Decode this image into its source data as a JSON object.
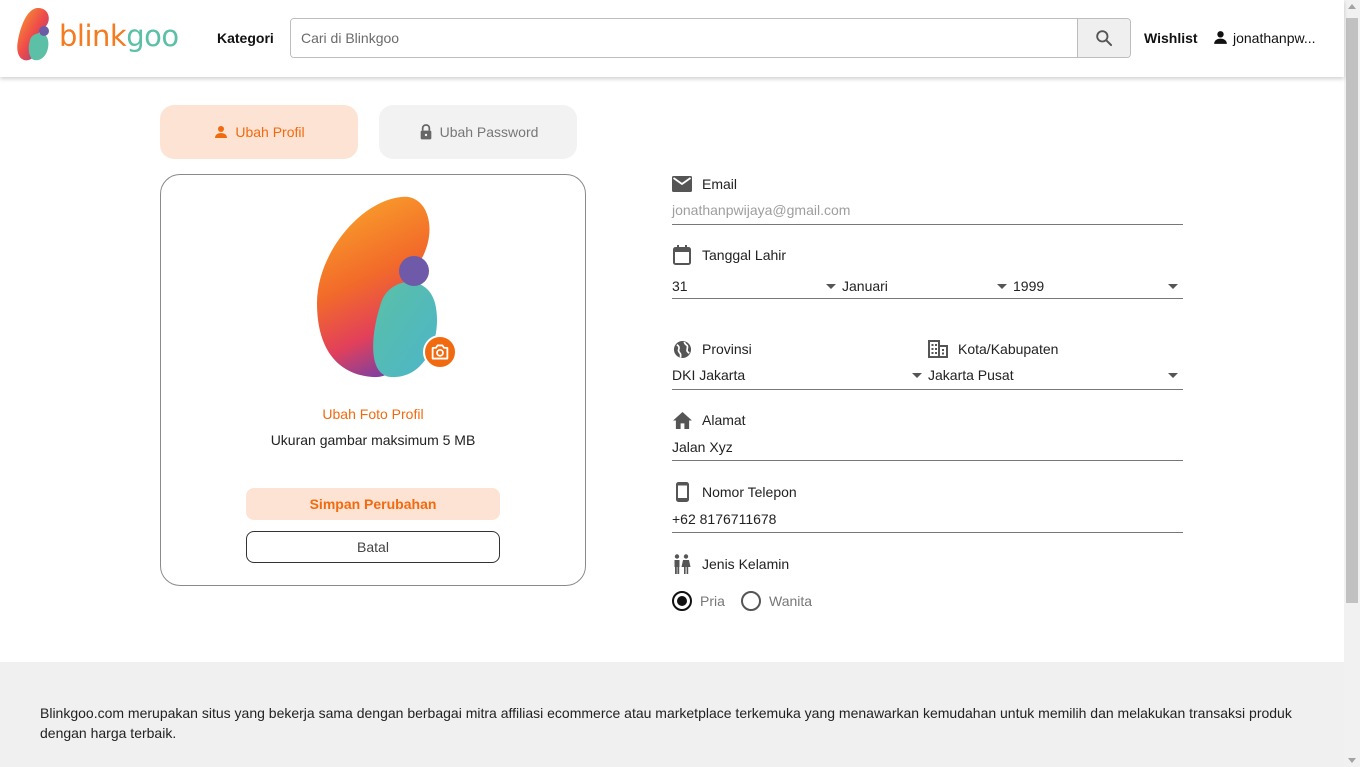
{
  "header": {
    "logo": {
      "part1": "blink",
      "part2": "goo"
    },
    "kategori": "Kategori",
    "search_placeholder": "Cari di Blinkgoo",
    "wishlist": "Wishlist",
    "username": "jonathanpw..."
  },
  "tabs": {
    "profile": "Ubah Profil",
    "password": "Ubah Password"
  },
  "card": {
    "change_photo": "Ubah Foto Profil",
    "size_note": "Ukuran gambar maksimum 5 MB",
    "save_button": "Simpan Perubahan",
    "cancel_button": "Batal"
  },
  "form": {
    "email": {
      "label": "Email",
      "value": "jonathanpwijaya@gmail.com"
    },
    "birthdate": {
      "label": "Tanggal Lahir",
      "day": "31",
      "month": "Januari",
      "year": "1999"
    },
    "province": {
      "label": "Provinsi",
      "value": "DKI Jakarta"
    },
    "city": {
      "label": "Kota/Kabupaten",
      "value": "Jakarta Pusat"
    },
    "address": {
      "label": "Alamat",
      "value": "Jalan Xyz"
    },
    "phone": {
      "label": "Nomor Telepon",
      "value": "+62 8176711678"
    },
    "gender": {
      "label": "Jenis Kelamin",
      "options": [
        "Pria",
        "Wanita"
      ],
      "selected": "Pria"
    }
  },
  "footer": {
    "text": "Blinkgoo.com merupakan situs yang bekerja sama dengan berbagai mitra affiliasi ecommerce atau marketplace terkemuka yang menawarkan kemudahan untuk memilih dan melakukan transaksi produk dengan harga terbaik."
  },
  "colors": {
    "accent": "#f26a10",
    "accent_light": "#fde3d3",
    "brand_teal": "#5bc0a6"
  }
}
